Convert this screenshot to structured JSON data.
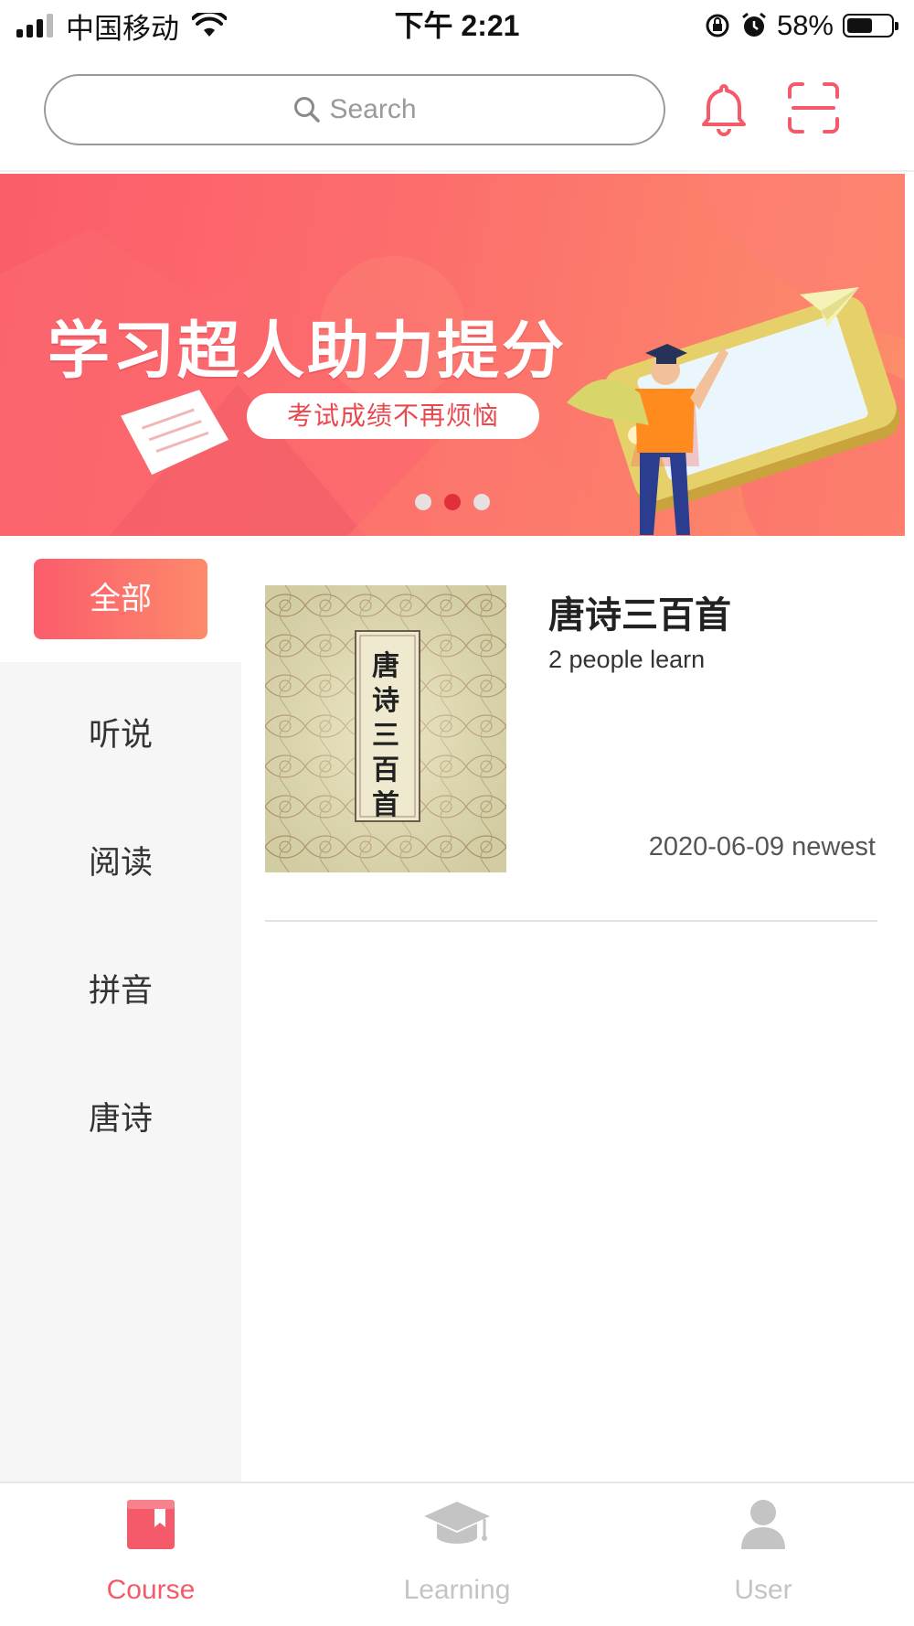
{
  "status_bar": {
    "carrier": "中国移动",
    "time": "下午 2:21",
    "battery_percent": "58%",
    "battery_level": 0.58
  },
  "header": {
    "search_placeholder": "Search",
    "icons": [
      "bell-icon",
      "scan-icon"
    ]
  },
  "banner": {
    "title": "学习超人助力提分",
    "subtitle": "考试成绩不再烦恼",
    "slide_count": 3,
    "active_slide": 2
  },
  "categories": {
    "active": "全部",
    "items": [
      "听说",
      "阅读",
      "拼音",
      "唐诗"
    ]
  },
  "course": {
    "title": "唐诗三百首",
    "cover_text": "唐诗三百首",
    "learners": "2 people learn",
    "date": "2020-06-09 newest"
  },
  "tabs": [
    {
      "label": "Course",
      "icon": "book-icon",
      "active": true
    },
    {
      "label": "Learning",
      "icon": "graduation-cap-icon",
      "active": false
    },
    {
      "label": "User",
      "icon": "user-icon",
      "active": false
    }
  ],
  "colors": {
    "accent": "#f45a6a",
    "banner_start": "#fb5d6b",
    "banner_end": "#fc8e6a",
    "inactive_tab": "#c4c4c4"
  }
}
